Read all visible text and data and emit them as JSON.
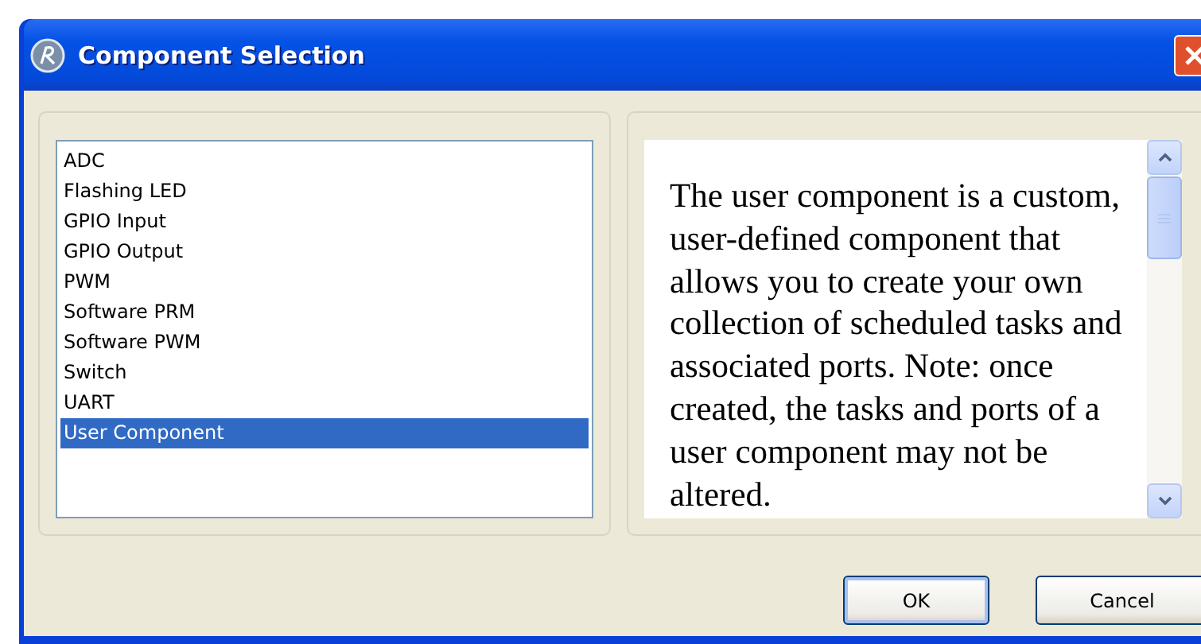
{
  "window": {
    "title": "Component Selection"
  },
  "components": [
    {
      "label": "ADC",
      "selected": false
    },
    {
      "label": "Flashing LED",
      "selected": false
    },
    {
      "label": "GPIO Input",
      "selected": false
    },
    {
      "label": "GPIO Output",
      "selected": false
    },
    {
      "label": "PWM",
      "selected": false
    },
    {
      "label": "Software PRM",
      "selected": false
    },
    {
      "label": "Software PWM",
      "selected": false
    },
    {
      "label": "Switch",
      "selected": false
    },
    {
      "label": "UART",
      "selected": false
    },
    {
      "label": "User Component",
      "selected": true
    }
  ],
  "description": "The user component is a custom, user-defined component that allows you to create your own collection of scheduled tasks and associated ports. Note: once created, the tasks and ports of a user component may not be altered.",
  "buttons": [
    {
      "label": "OK",
      "kind": "default"
    },
    {
      "label": "Cancel",
      "kind": "normal"
    }
  ]
}
